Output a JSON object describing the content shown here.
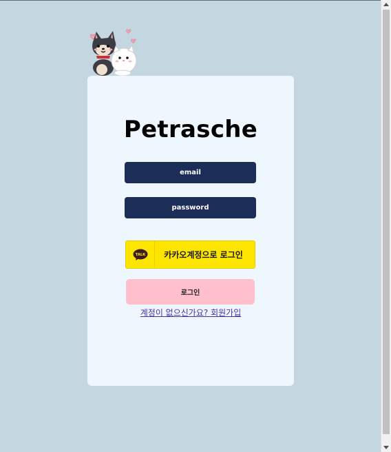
{
  "app": {
    "title": "Petrasche"
  },
  "form": {
    "email_placeholder": "email",
    "password_placeholder": "password",
    "kakao_label": "카카오계정으로 로그인",
    "kakao_icon_text": "TALK",
    "login_label": "로그인",
    "signup_link": "계정이 없으신가요? 회원가입"
  },
  "colors": {
    "background": "#c4d6df",
    "card": "#eef7fd",
    "field": "#1c2e58",
    "kakao": "#fee500",
    "login": "#ffbfcb",
    "link": "#4a2fa8"
  },
  "icons": {
    "mascot": "dog-and-cat-mascot-icon",
    "kakao": "kakao-talk-icon"
  }
}
